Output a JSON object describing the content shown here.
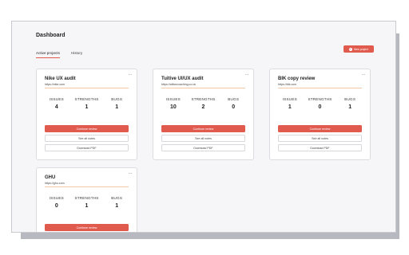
{
  "page": {
    "title": "Dashboard"
  },
  "tabs": [
    {
      "label": "Active projects",
      "active": true
    },
    {
      "label": "History",
      "active": false
    }
  ],
  "new_project_label": "New project",
  "stat_labels": {
    "issues": "ISSUES",
    "strengths": "STRENGTHS",
    "bugs": "BUGS"
  },
  "buttons": {
    "continue": "Continue review",
    "notes": "See all notes",
    "pdf": "Download PDF"
  },
  "projects": [
    {
      "title": "Nike UX audit",
      "url": "https://nike.com",
      "issues": "4",
      "strengths": "1",
      "bugs": "1"
    },
    {
      "title": "Tuitive UI/UX audit",
      "url": "https://altivecoaching.co.uk",
      "issues": "10",
      "strengths": "2",
      "bugs": "0"
    },
    {
      "title": "BIK copy review",
      "url": "https://bik.com",
      "issues": "1",
      "strengths": "0",
      "bugs": "1"
    },
    {
      "title": "GHU",
      "url": "https://ghu.com",
      "issues": "0",
      "strengths": "1",
      "bugs": "1"
    }
  ],
  "colors": {
    "accent": "#e05a4e",
    "background": "#f6f6f8"
  },
  "icons": {
    "more": "more-dots-icon",
    "new": "plus-circle-icon"
  }
}
